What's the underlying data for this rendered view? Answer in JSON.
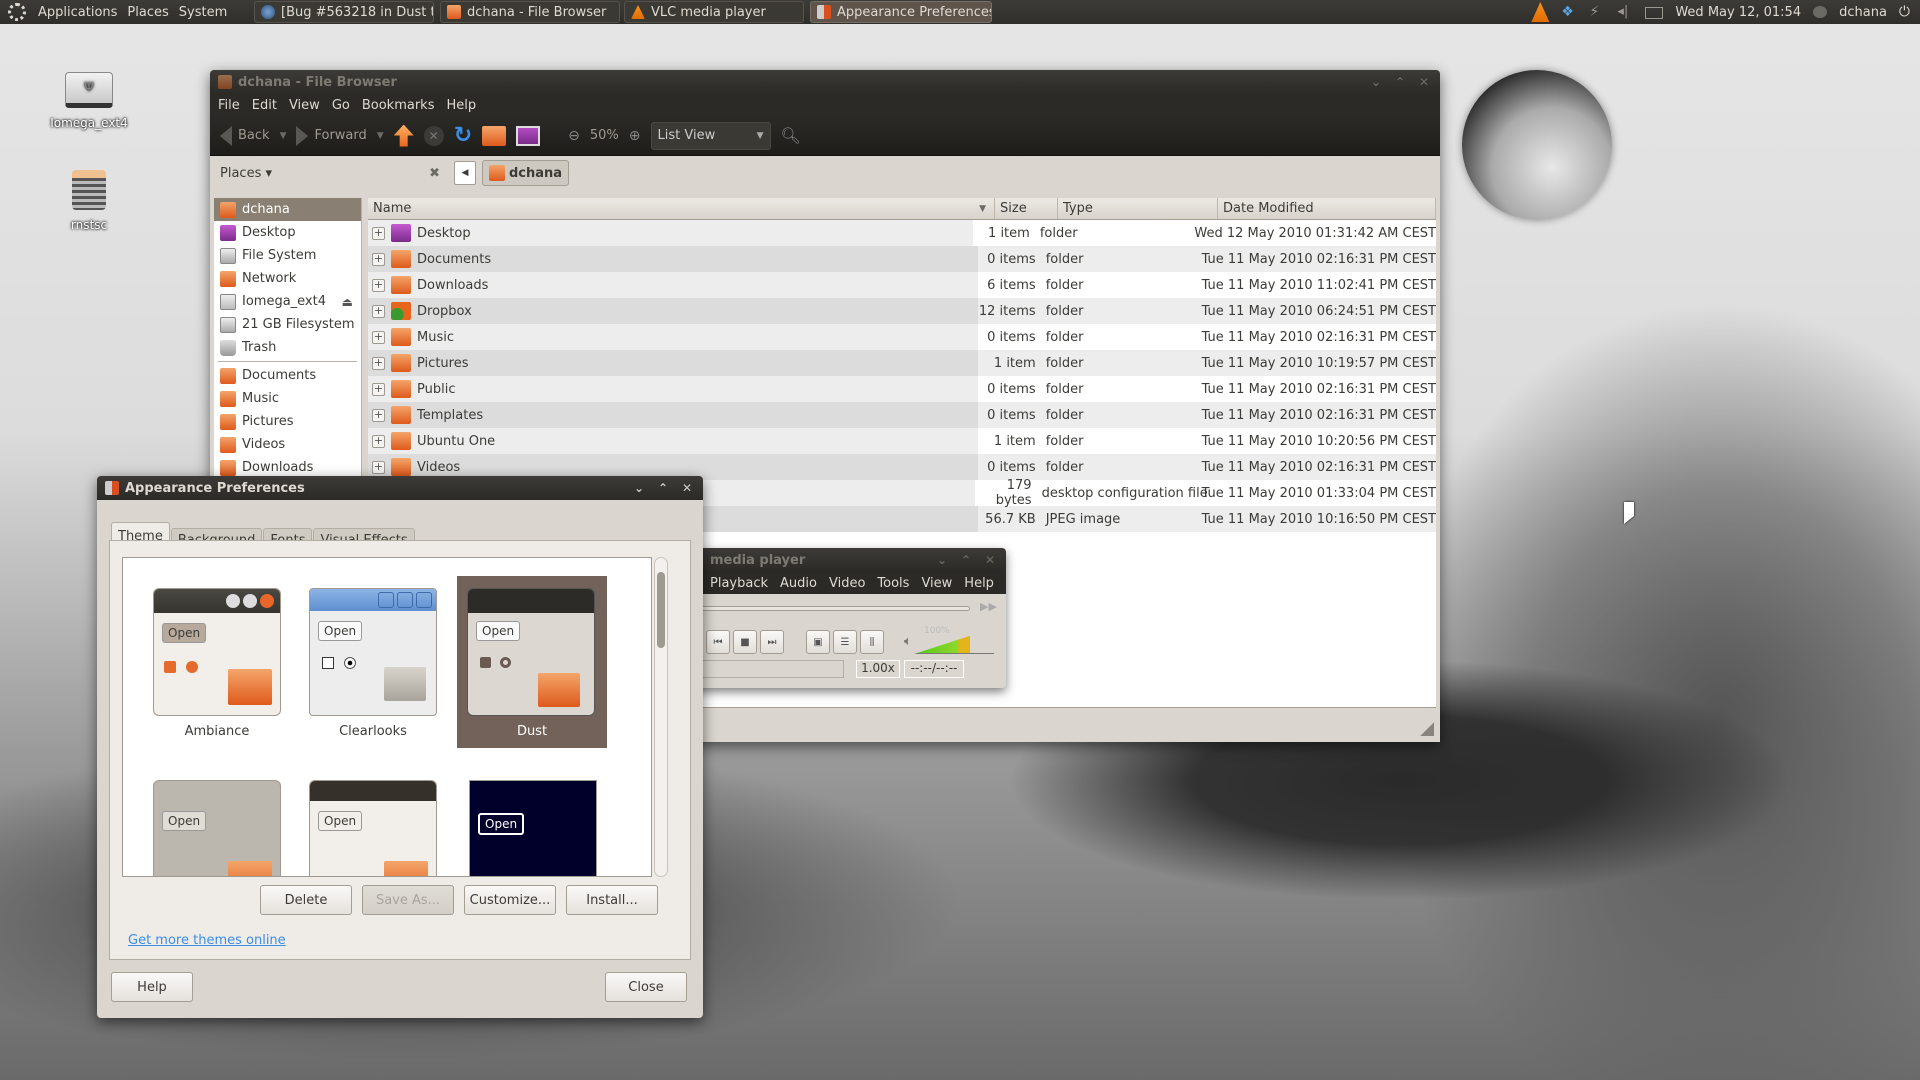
{
  "panel": {
    "menus": [
      "Applications",
      "Places",
      "System"
    ],
    "tasks": [
      {
        "label": "[Bug #563218 in Dust t...",
        "icon": "browser-icon",
        "active": false
      },
      {
        "label": "dchana - File Browser",
        "icon": "folder-icon",
        "active": false
      },
      {
        "label": "VLC media player",
        "icon": "vlc-cone-icon",
        "active": false
      },
      {
        "label": "Appearance Preferences",
        "icon": "appearance-icon",
        "active": true
      }
    ],
    "tray": {
      "icons": [
        "vlc-cone-icon",
        "dropbox-icon",
        "network-plug-icon",
        "volume-icon",
        "mail-icon"
      ],
      "clock": "Wed May 12, 01:54",
      "user": "dchana"
    }
  },
  "desktop": {
    "icons": [
      {
        "label": "Iomega_ext4",
        "icon": "usb-drive-icon"
      },
      {
        "label": "rnstsc",
        "icon": "spring-icon"
      }
    ]
  },
  "file_browser": {
    "title": "dchana - File Browser",
    "menu": [
      "File",
      "Edit",
      "View",
      "Go",
      "Bookmarks",
      "Help"
    ],
    "toolbar": {
      "back": "Back",
      "forward": "Forward",
      "zoom": "50%",
      "view_mode": "List View"
    },
    "places_label": "Places",
    "path": "dchana",
    "sidebar": {
      "devices": [
        {
          "label": "dchana",
          "icon": "home-folder-icon",
          "selected": true
        },
        {
          "label": "Desktop",
          "icon": "desktop-icon"
        },
        {
          "label": "File System",
          "icon": "harddisk-icon"
        },
        {
          "label": "Network",
          "icon": "network-icon"
        },
        {
          "label": "Iomega_ext4",
          "icon": "usb-drive-icon",
          "eject": true
        },
        {
          "label": "21 GB Filesystem",
          "icon": "harddisk-icon"
        },
        {
          "label": "Trash",
          "icon": "trash-icon"
        }
      ],
      "bookmarks": [
        {
          "label": "Documents",
          "icon": "documents-folder-icon"
        },
        {
          "label": "Music",
          "icon": "music-folder-icon"
        },
        {
          "label": "Pictures",
          "icon": "pictures-folder-icon"
        },
        {
          "label": "Videos",
          "icon": "videos-folder-icon"
        },
        {
          "label": "Downloads",
          "icon": "downloads-folder-icon"
        }
      ]
    },
    "columns": [
      "Name",
      "Size",
      "Type",
      "Date Modified"
    ],
    "files": [
      {
        "name": "Desktop",
        "size": "1 item",
        "type": "folder",
        "date": "Wed 12 May 2010 01:31:42 AM CEST",
        "icon": "desktop-icon"
      },
      {
        "name": "Documents",
        "size": "0 items",
        "type": "folder",
        "date": "Tue 11 May 2010 02:16:31 PM CEST",
        "icon": "documents-folder-icon"
      },
      {
        "name": "Downloads",
        "size": "6 items",
        "type": "folder",
        "date": "Tue 11 May 2010 11:02:41 PM CEST",
        "icon": "downloads-folder-icon"
      },
      {
        "name": "Dropbox",
        "size": "12 items",
        "type": "folder",
        "date": "Tue 11 May 2010 06:24:51 PM CEST",
        "icon": "dropbox-folder-icon"
      },
      {
        "name": "Music",
        "size": "0 items",
        "type": "folder",
        "date": "Tue 11 May 2010 02:16:31 PM CEST",
        "icon": "music-folder-icon"
      },
      {
        "name": "Pictures",
        "size": "1 item",
        "type": "folder",
        "date": "Tue 11 May 2010 10:19:57 PM CEST",
        "icon": "pictures-folder-icon"
      },
      {
        "name": "Public",
        "size": "0 items",
        "type": "folder",
        "date": "Tue 11 May 2010 02:16:31 PM CEST",
        "icon": "public-folder-icon"
      },
      {
        "name": "Templates",
        "size": "0 items",
        "type": "folder",
        "date": "Tue 11 May 2010 02:16:31 PM CEST",
        "icon": "templates-folder-icon"
      },
      {
        "name": "Ubuntu One",
        "size": "1 item",
        "type": "folder",
        "date": "Tue 11 May 2010 10:20:56 PM CEST",
        "icon": "ubuntu-one-folder-icon"
      },
      {
        "name": "Videos",
        "size": "0 items",
        "type": "folder",
        "date": "Tue 11 May 2010 02:16:31 PM CEST",
        "icon": "videos-folder-icon"
      },
      {
        "name": "",
        "size": "179 bytes",
        "type": "desktop configuration file",
        "date": "Tue 11 May 2010 01:33:04 PM CEST",
        "icon": "file-icon"
      },
      {
        "name": "",
        "size": "56.7 KB",
        "type": "JPEG image",
        "date": "Tue 11 May 2010 10:16:50 PM CEST",
        "icon": "image-icon"
      }
    ]
  },
  "vlc": {
    "title": "media player",
    "menu": [
      "Playback",
      "Audio",
      "Video",
      "Tools",
      "View",
      "Help"
    ],
    "speed": "1.00x",
    "time": "--:--/--:--",
    "volume_label": "100%",
    "volume_percent": 100
  },
  "appearance": {
    "title": "Appearance Preferences",
    "tabs": [
      "Theme",
      "Background",
      "Fonts",
      "Visual Effects"
    ],
    "selected_tab": "Theme",
    "themes": [
      {
        "name": "Ambiance",
        "selected": false
      },
      {
        "name": "Clearlooks",
        "selected": false
      },
      {
        "name": "Dust",
        "selected": true
      },
      {
        "name": "",
        "selected": false
      },
      {
        "name": "",
        "selected": false
      },
      {
        "name": "",
        "selected": false
      }
    ],
    "thumb_button": "Open",
    "buttons": {
      "delete": "Delete",
      "save_as": "Save As...",
      "customize": "Customize...",
      "install": "Install..."
    },
    "link": "Get more themes online",
    "help": "Help",
    "close": "Close"
  }
}
